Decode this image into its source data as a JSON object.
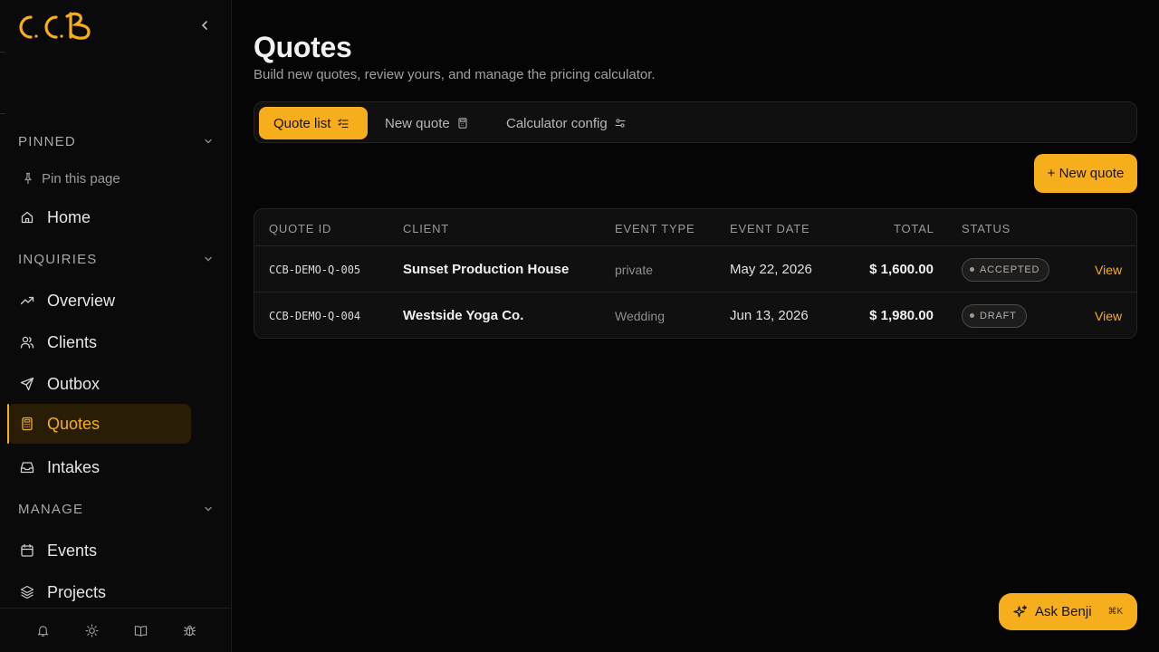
{
  "brand": {
    "logo_text": "C.C.B",
    "accent": "#f6ae1c"
  },
  "sidebar": {
    "sections": {
      "pinned": "PINNED",
      "inquiries": "INQUIRIES",
      "manage": "MANAGE"
    },
    "pin_label": "Pin this page",
    "items": {
      "home": "Home",
      "overview": "Overview",
      "clients": "Clients",
      "outbox": "Outbox",
      "quotes": "Quotes",
      "intakes": "Intakes",
      "events": "Events",
      "projects": "Projects"
    },
    "active_item": "Quotes",
    "footer_icons": [
      "bell-icon",
      "sun-icon",
      "book-icon",
      "bug-icon"
    ]
  },
  "page": {
    "title": "Quotes",
    "subtitle": "Build new quotes, review yours, and manage the pricing calculator."
  },
  "tabs": [
    {
      "label": "Quote list",
      "icon": "list-check-icon",
      "active": true
    },
    {
      "label": "New quote",
      "icon": "calculator-icon",
      "active": false
    },
    {
      "label": "Calculator config",
      "icon": "sliders-icon",
      "active": false
    }
  ],
  "new_quote_button": "+ New quote",
  "table": {
    "headers": {
      "quote_id": "QUOTE ID",
      "client": "CLIENT",
      "event_type": "EVENT TYPE",
      "event_date": "EVENT DATE",
      "total": "TOTAL",
      "status": "STATUS"
    },
    "rows": [
      {
        "quote_id": "CCB-DEMO-Q-005",
        "client": "Sunset Production House",
        "event_type": "private",
        "event_date": "May 22, 2026",
        "total": "$ 1,600.00",
        "status": "ACCEPTED",
        "action": "View"
      },
      {
        "quote_id": "CCB-DEMO-Q-004",
        "client": "Westside Yoga Co.",
        "event_type": "Wedding",
        "event_date": "Jun 13, 2026",
        "total": "$ 1,980.00",
        "status": "DRAFT",
        "action": "View"
      }
    ]
  },
  "assistant": {
    "label": "Ask Benji",
    "shortcut": "⌘K"
  }
}
